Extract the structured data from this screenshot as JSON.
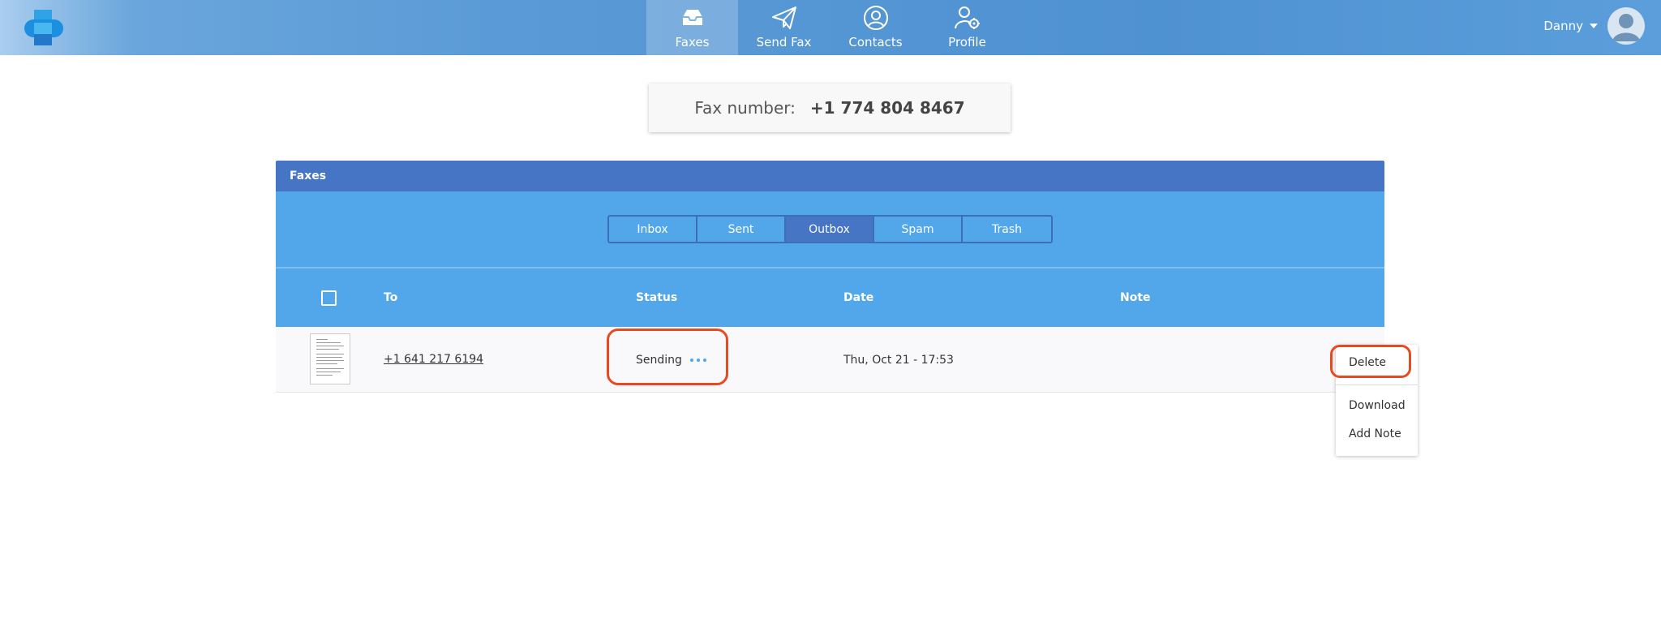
{
  "nav": {
    "items": [
      {
        "label": "Faxes",
        "icon": "inbox-tray-icon",
        "active": true
      },
      {
        "label": "Send Fax",
        "icon": "paper-plane-icon",
        "active": false
      },
      {
        "label": "Contacts",
        "icon": "person-circle-icon",
        "active": false
      },
      {
        "label": "Profile",
        "icon": "user-gear-icon",
        "active": false
      }
    ]
  },
  "user": {
    "name": "Danny"
  },
  "fax_number": {
    "label": "Fax number:",
    "value": "+1 774 804 8467"
  },
  "panel": {
    "title": "Faxes",
    "tabs": [
      {
        "label": "Inbox",
        "active": false
      },
      {
        "label": "Sent",
        "active": false
      },
      {
        "label": "Outbox",
        "active": true
      },
      {
        "label": "Spam",
        "active": false
      },
      {
        "label": "Trash",
        "active": false
      }
    ],
    "columns": {
      "to": "To",
      "status": "Status",
      "date": "Date",
      "note": "Note"
    },
    "rows": [
      {
        "to": "+1 641 217 6194",
        "status": "Sending",
        "date": "Thu, Oct 21 - 17:53",
        "note": ""
      }
    ]
  },
  "row_menu": {
    "delete": "Delete",
    "download": "Download",
    "add_note": "Add Note"
  },
  "colors": {
    "accent": "#52a6ea",
    "header": "#4575c4",
    "highlight": "#e84a20"
  }
}
